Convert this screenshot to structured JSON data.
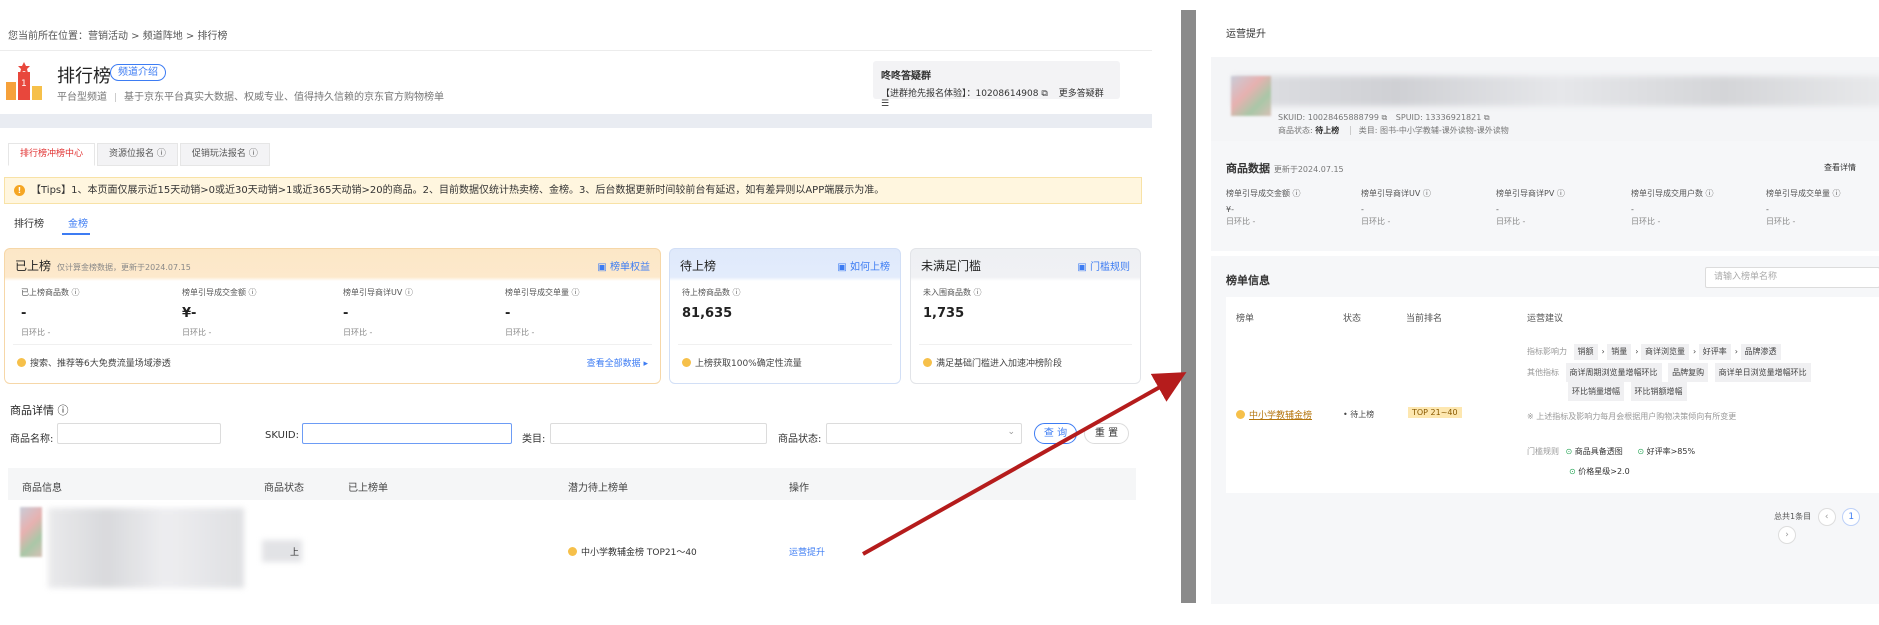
{
  "left": {
    "breadcrumb": "您当前所在位置：营销活动 > 频道阵地 > 排行榜",
    "title": "排行榜",
    "intro_pill": "频道介绍",
    "subtitle_a": "平台型频道",
    "subtitle_b": "基于京东平台真实大数据、权威专业、值得持久信赖的京东官方购物榜单",
    "group": {
      "title": "咚咚答疑群",
      "line": "【进群抢先报名体验】：10208614908",
      "more": "更多答疑群"
    },
    "tabs": [
      "排行榜冲榜中心",
      "资源位报名",
      "促销玩法报名"
    ],
    "tips": "【Tips】1、本页面仅展示近15天动销>0或近30天动销>1或近365天动销>20的商品。2、目前数据仅统计热卖榜、金榜。3、后台数据更新时间较前台有延迟，如有差异则以APP端展示为准。",
    "subtabs": [
      "排行榜",
      "金榜"
    ],
    "card1": {
      "title": "已上榜",
      "note": "仅计算金榜数据，更新于2024.07.15",
      "link": "榜单权益",
      "metrics": [
        {
          "label": "已上榜商品数",
          "value": "-",
          "rate": "日环比 -"
        },
        {
          "label": "榜单引导成交金额",
          "value": "¥-",
          "rate": "日环比 -"
        },
        {
          "label": "榜单引导商详UV",
          "value": "-",
          "rate": "日环比 -"
        },
        {
          "label": "榜单引导成交单量",
          "value": "-",
          "rate": "日环比 -"
        }
      ],
      "foot": "搜索、推荐等6大免费流量场域渗透",
      "foot_link": "查看全部数据"
    },
    "card2": {
      "title": "待上榜",
      "link": "如何上榜",
      "label": "待上榜商品数",
      "value": "81,635",
      "foot": "上榜获取100%确定性流量"
    },
    "card3": {
      "title": "未满足门槛",
      "link": "门槛规则",
      "label": "未入围商品数",
      "value": "1,735",
      "foot": "满足基础门槛进入加速冲榜阶段"
    },
    "detail": {
      "title": "商品详情",
      "name_label": "商品名称:",
      "sku_label": "SKUID:",
      "cat_label": "类目:",
      "status_label": "商品状态:",
      "query": "查 询",
      "reset": "重 置",
      "headers": [
        "商品信息",
        "商品状态",
        "已上榜单",
        "潜力待上榜单",
        "操作"
      ],
      "row": {
        "status": "上",
        "potential": "中小学教辅金榜 TOP21～40",
        "action": "运营提升"
      }
    }
  },
  "right": {
    "title": "运营提升",
    "sku_line": "SKUID: 10028465888799",
    "spuid_line": "SPUID: 13336921821",
    "status_line_a": "商品状态:",
    "status_line_b": "待上榜",
    "cat_line": "类目: 图书-中小学教辅-课外读物-课外读物",
    "data_title": "商品数据",
    "data_note": "更新于2024.07.15",
    "data_more": "查看详情",
    "metrics": [
      {
        "label": "榜单引导成交金额",
        "value": "¥-",
        "rate": "日环比 -"
      },
      {
        "label": "榜单引导商详UV",
        "value": "-",
        "rate": "日环比 -"
      },
      {
        "label": "榜单引导商详PV",
        "value": "-",
        "rate": "日环比 -"
      },
      {
        "label": "榜单引导成交用户数",
        "value": "-",
        "rate": "日环比 -"
      },
      {
        "label": "榜单引导成交单量",
        "value": "-",
        "rate": "日环比 -"
      }
    ],
    "rank_title": "榜单信息",
    "search_placeholder": "请输入榜单名称",
    "headers": [
      "榜单",
      "状态",
      "当前排名",
      "运营建议"
    ],
    "row": {
      "name": "中小学教辅金榜",
      "status": "待上榜",
      "rank": "TOP 21~40",
      "factor_label": "指标影响力",
      "factors": [
        "销额",
        "销量",
        "商详浏览量",
        "好评率",
        "品牌渗透"
      ],
      "other_label": "其他指标",
      "others": [
        "商详周期浏览量增幅环比",
        "品牌复购",
        "商详单日浏览量增幅环比",
        "环比销量增幅",
        "环比销额增幅"
      ],
      "hint": "※ 上述指标及影响力每月会根据用户购物决策倾向有所变更",
      "gate_label": "门槛规则",
      "gates": [
        "商品具备透图",
        "好评率>85%",
        "价格星级>2.0"
      ]
    },
    "total": "总共1条目",
    "page": "1"
  }
}
